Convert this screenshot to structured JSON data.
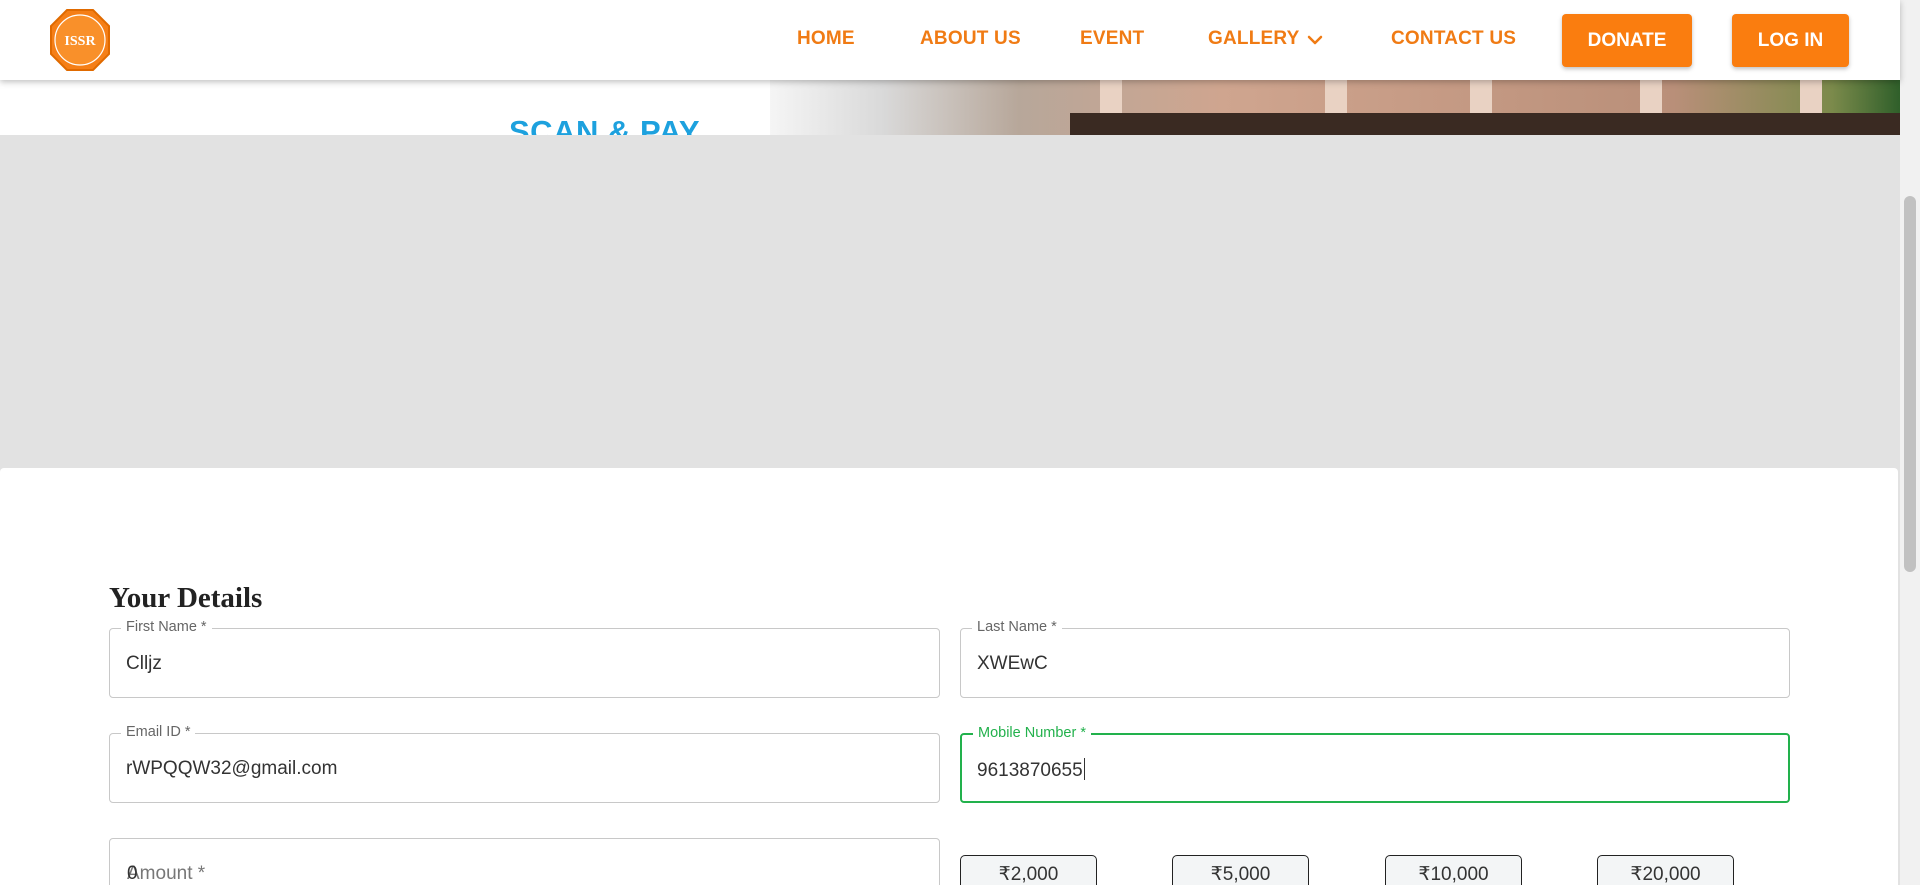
{
  "nav": {
    "logo_text": "ISSR",
    "links": [
      "HOME",
      "ABOUT US",
      "EVENT",
      "GALLERY",
      "CONTACT US"
    ],
    "donate": "DONATE",
    "login": "LOG IN"
  },
  "banner": {
    "scan_text": "SCAN & PAY"
  },
  "form": {
    "title": "Your Details",
    "first_name": {
      "label": "First Name *",
      "value": "Cllјz"
    },
    "last_name": {
      "label": "Last Name *",
      "value": "XWEwC"
    },
    "email": {
      "label": "Email ID *",
      "value": "rWPQQW32@gmail.com"
    },
    "mobile": {
      "label": "Mobile Number *",
      "value": "9613870655"
    },
    "amount": {
      "label": "Amount *",
      "value": "0"
    },
    "preset_amounts": [
      "₹2,000",
      "₹5,000",
      "₹10,000",
      "₹20,000"
    ]
  },
  "colors": {
    "brand_orange": "#f07b14",
    "button_orange": "#fa7d0f",
    "focus_green": "#22b14c",
    "scan_blue": "#1da1de"
  }
}
